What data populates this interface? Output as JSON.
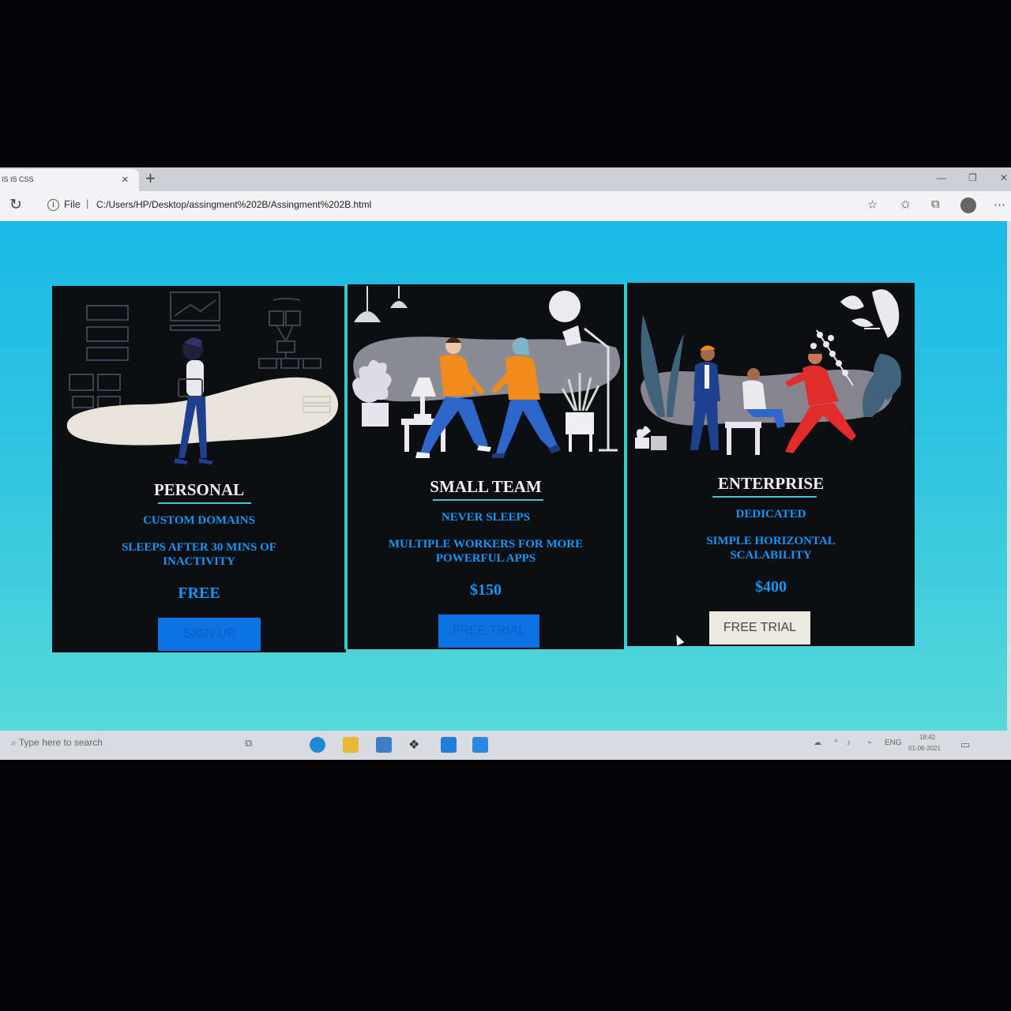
{
  "browser": {
    "tab_title": "IS IS CSS",
    "close_glyph": "×",
    "new_tab_glyph": "+",
    "file_label": "File",
    "url": "C:/Users/HP/Desktop/assingment%202B/Assingment%202B.html"
  },
  "plans": [
    {
      "title": "PERSONAL",
      "features": [
        "CUSTOM DOMAINS",
        "SLEEPS AFTER 30 MINS OF INACTIVITY"
      ],
      "price": "FREE",
      "button": "SIGN UP"
    },
    {
      "title": "SMALL TEAM",
      "features": [
        "NEVER SLEEPS",
        "MULTIPLE WORKERS FOR MORE POWERFUL APPS"
      ],
      "price": "$150",
      "button": "FREE TRIAL"
    },
    {
      "title": "ENTERPRISE",
      "features": [
        "DEDICATED",
        "SIMPLE HORIZONTAL SCALABILITY"
      ],
      "price": "$400",
      "button": "FREE TRIAL"
    }
  ],
  "taskbar": {
    "search_placeholder": "Type here to search",
    "language": "ENG",
    "time": "18:42",
    "date": "01-06-2021"
  },
  "colors": {
    "page_gradient_top": "#19b9e6",
    "page_gradient_bottom": "#55d9d8",
    "card_bg": "#0c0e11",
    "accent_blue": "#1597f7",
    "button_blue": "#0c73e3"
  }
}
